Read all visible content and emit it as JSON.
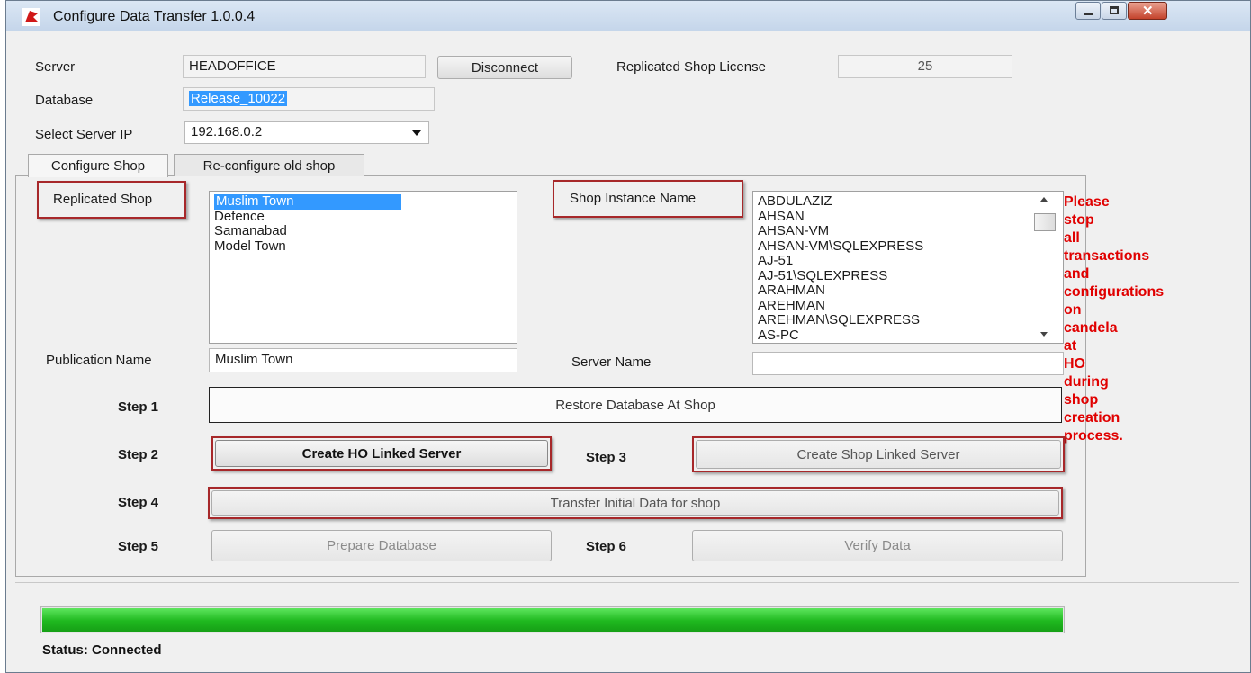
{
  "window": {
    "title": "Configure Data Transfer 1.0.0.4"
  },
  "header": {
    "server_label": "Server",
    "server_value": "HEADOFFICE",
    "disconnect_label": "Disconnect",
    "license_label": "Replicated Shop License",
    "license_value": "25",
    "database_label": "Database",
    "database_value": "Release_10022",
    "server_ip_label": "Select Server IP",
    "server_ip_value": "192.168.0.2"
  },
  "tabs": [
    {
      "label": "Configure Shop",
      "active": true
    },
    {
      "label": "Re-configure old shop",
      "active": false
    }
  ],
  "configure": {
    "replicated_shop_label": "Replicated Shop",
    "shops": [
      "Muslim Town",
      "Defence",
      "Samanabad",
      "Model Town"
    ],
    "selected_shop": "Muslim Town",
    "instance_label": "Shop Instance Name",
    "instances": [
      "ABDULAZIZ",
      "AHSAN",
      "AHSAN-VM",
      "AHSAN-VM\\SQLEXPRESS",
      "AJ-51",
      "AJ-51\\SQLEXPRESS",
      "ARAHMAN",
      "AREHMAN",
      "AREHMAN\\SQLEXPRESS",
      "AS-PC"
    ],
    "publication_label": "Publication Name",
    "publication_value": "Muslim Town",
    "server_name_label": "Server Name",
    "server_name_value": "",
    "warning_lines": [
      "Please",
      "stop",
      "all",
      "transactions",
      "and",
      "configurations",
      "on",
      "candela",
      "at",
      "HO",
      "during",
      "shop",
      "creation",
      "process."
    ]
  },
  "steps": {
    "step1_label": "Step 1",
    "step1_button": "Restore Database At Shop",
    "step2_label": "Step 2",
    "step2_button": "Create HO Linked Server",
    "step3_label": "Step 3",
    "step3_button": "Create Shop Linked Server",
    "step4_label": "Step 4",
    "step4_button": "Transfer Initial Data for shop",
    "step5_label": "Step 5",
    "step5_button": "Prepare Database",
    "step6_label": "Step 6",
    "step6_button": "Verify Data"
  },
  "progress": {
    "value_percent": 100,
    "color": "#22c022"
  },
  "status": {
    "text": "Status: Connected"
  }
}
